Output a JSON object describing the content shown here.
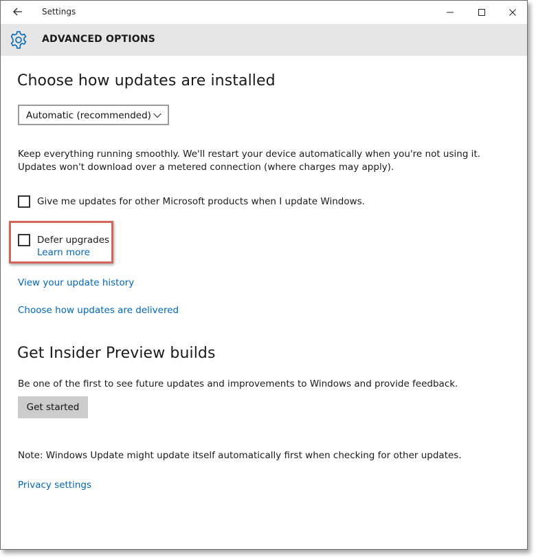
{
  "window": {
    "title": "Settings",
    "back_icon": "arrow-left-icon",
    "controls": [
      "minimize-icon",
      "maximize-icon",
      "close-icon"
    ]
  },
  "header": {
    "icon": "gear-icon",
    "title": "ADVANCED OPTIONS"
  },
  "install_section": {
    "heading": "Choose how updates are installed",
    "dropdown_value": "Automatic (recommended)",
    "description": "Keep everything running smoothly. We'll restart your device automatically when you're not using it. Updates won't download over a metered connection (where charges may apply).",
    "ms_products_checkbox": {
      "label": "Give me updates for other Microsoft products when I update Windows.",
      "checked": false
    },
    "defer_checkbox": {
      "label": "Defer upgrades",
      "checked": false
    },
    "learn_more": "Learn more",
    "history_link": "View your update history",
    "delivered_link": "Choose how updates are delivered"
  },
  "insider_section": {
    "heading": "Get Insider Preview builds",
    "description": "Be one of the first to see future updates and improvements to Windows and provide feedback.",
    "button": "Get started"
  },
  "note": "Note: Windows Update might update itself automatically first when checking for other updates.",
  "privacy_link": "Privacy settings",
  "colors": {
    "accent": "#0067b8",
    "header_band": "#e6e6e6",
    "highlight_border": "#d2655c",
    "button_bg": "#cccccc"
  }
}
